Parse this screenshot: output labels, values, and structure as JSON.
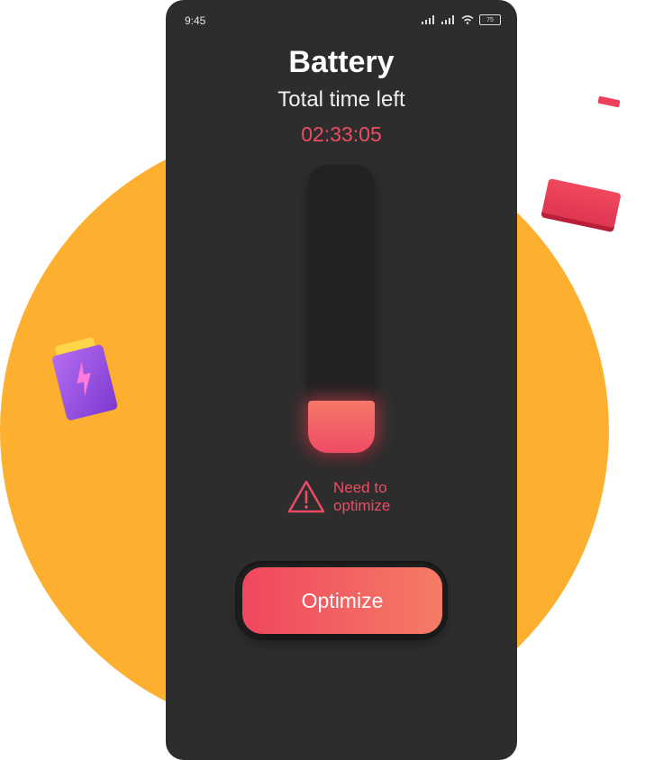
{
  "status_bar": {
    "time": "9:45",
    "battery_level": "75"
  },
  "screen": {
    "title": "Battery",
    "subtitle": "Total time left",
    "time_left": "02:33:05"
  },
  "battery_meter": {
    "fill_fraction": 0.18,
    "fill_color": "#ef4c64"
  },
  "warning": {
    "text": "Need to optimize"
  },
  "actions": {
    "optimize_label": "Optimize"
  },
  "colors": {
    "accent": "#ee4c63",
    "background_circle": "#fdb02f",
    "phone_background": "#2d2d2d"
  }
}
